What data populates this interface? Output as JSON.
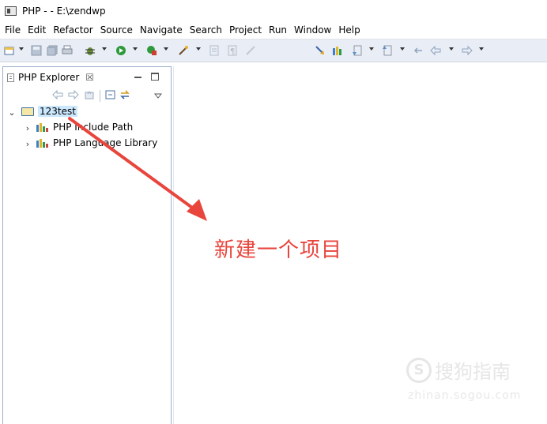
{
  "window": {
    "title": "PHP -  - E:\\zendwp"
  },
  "menubar": {
    "items": [
      "File",
      "Edit",
      "Refactor",
      "Source",
      "Navigate",
      "Search",
      "Project",
      "Run",
      "Window",
      "Help"
    ]
  },
  "explorer": {
    "tab_label": "PHP Explorer",
    "tab_close": "☒",
    "tree": {
      "project": {
        "label": "123test"
      },
      "children": [
        {
          "label": "PHP Include Path"
        },
        {
          "label": "PHP Language Library"
        }
      ]
    }
  },
  "annotation": {
    "text": "新建一个项目",
    "color": "#e8453c"
  },
  "watermark": {
    "brand": "搜狗指南",
    "logo": "S",
    "url": "zhinan.sogou.com"
  },
  "colors": {
    "toolbar_bg": "#e9eef6",
    "panel_border": "#9aaec9",
    "selection": "#cce8ff",
    "annotation": "#e8453c"
  }
}
